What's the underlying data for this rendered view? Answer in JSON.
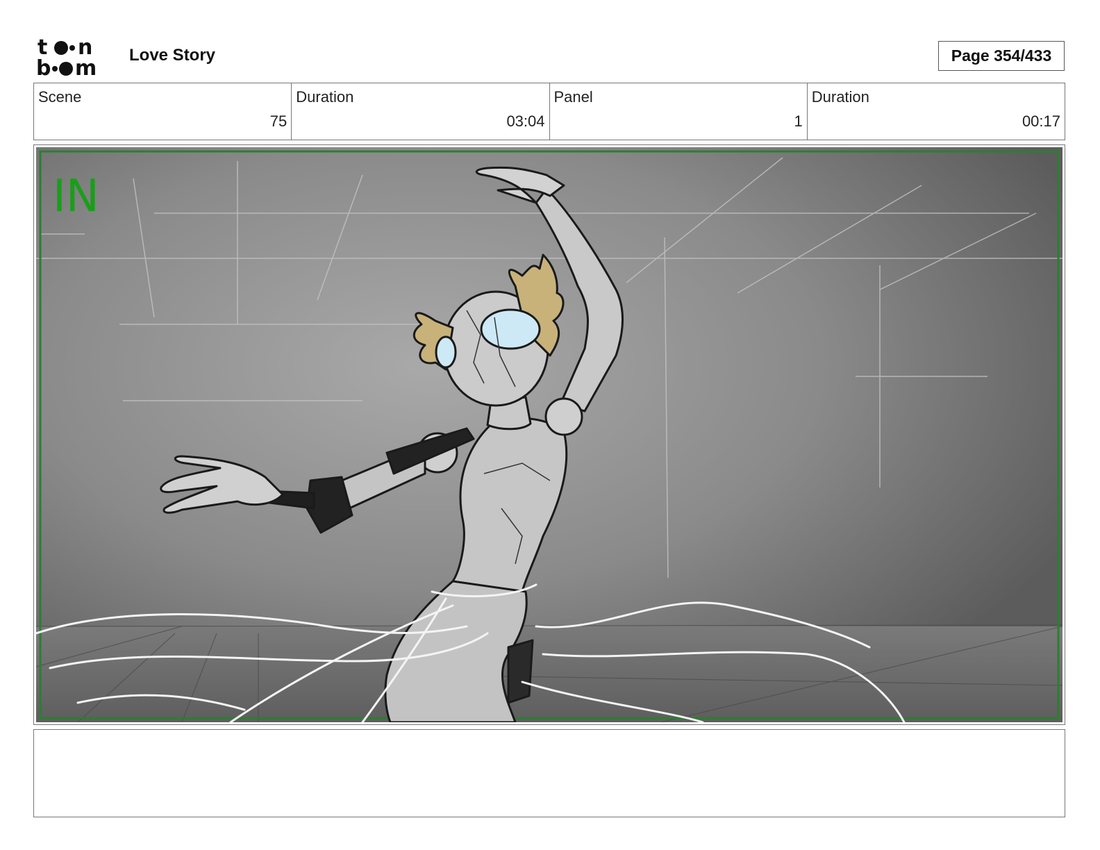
{
  "header": {
    "logo_text": "toon boom",
    "project_title": "Love Story",
    "page_label": "Page 354/433"
  },
  "info": {
    "scene_label": "Scene",
    "scene_value": "75",
    "scene_duration_label": "Duration",
    "scene_duration_value": "03:04",
    "panel_label": "Panel",
    "panel_value": "1",
    "panel_duration_label": "Duration",
    "panel_duration_value": "00:17"
  },
  "panel": {
    "marker_text": "IN",
    "marker_color": "#1a9e1a",
    "safe_frame_color": "#2e7d32",
    "hair_color": "#c8b27a",
    "visor_color": "#cde9f6"
  },
  "caption": {
    "text": ""
  }
}
